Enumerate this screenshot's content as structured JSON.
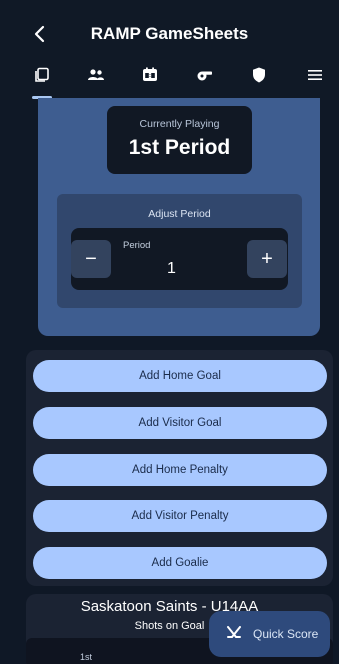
{
  "header": {
    "title": "RAMP GameSheets",
    "back_icon": "chevron-left-icon"
  },
  "tabs": [
    {
      "name": "tab-gamesheet",
      "icon": "copy-icon",
      "active": true
    },
    {
      "name": "tab-players",
      "icon": "people-icon"
    },
    {
      "name": "tab-scoreboard",
      "icon": "scoreboard-icon"
    },
    {
      "name": "tab-officials",
      "icon": "whistle-icon"
    },
    {
      "name": "tab-team",
      "icon": "shield-icon"
    },
    {
      "name": "tab-menu",
      "icon": "hamburger-menu-icon"
    }
  ],
  "current_period": {
    "label": "Currently Playing",
    "value": "1st Period"
  },
  "adjust_period": {
    "label": "Adjust Period",
    "field_label": "Period",
    "value": "1",
    "decrement_symbol": "−",
    "increment_symbol": "+"
  },
  "actions": [
    {
      "label": "Add Home Goal"
    },
    {
      "label": "Add Visitor Goal"
    },
    {
      "label": "Add Home Penalty"
    },
    {
      "label": "Add Visitor Penalty"
    },
    {
      "label": "Add Goalie"
    }
  ],
  "shots": {
    "team_name": "Saskatoon Saints - U14AA",
    "label": "Shots on Goal",
    "first_period_label": "1st"
  },
  "quick_score": {
    "label": "Quick Score",
    "icon": "hockey-sticks-icon"
  },
  "colors": {
    "background": "#0f1826",
    "panel": "#3e5d90",
    "action_button": "#a8c8ff",
    "fab": "#2e4a7c"
  }
}
